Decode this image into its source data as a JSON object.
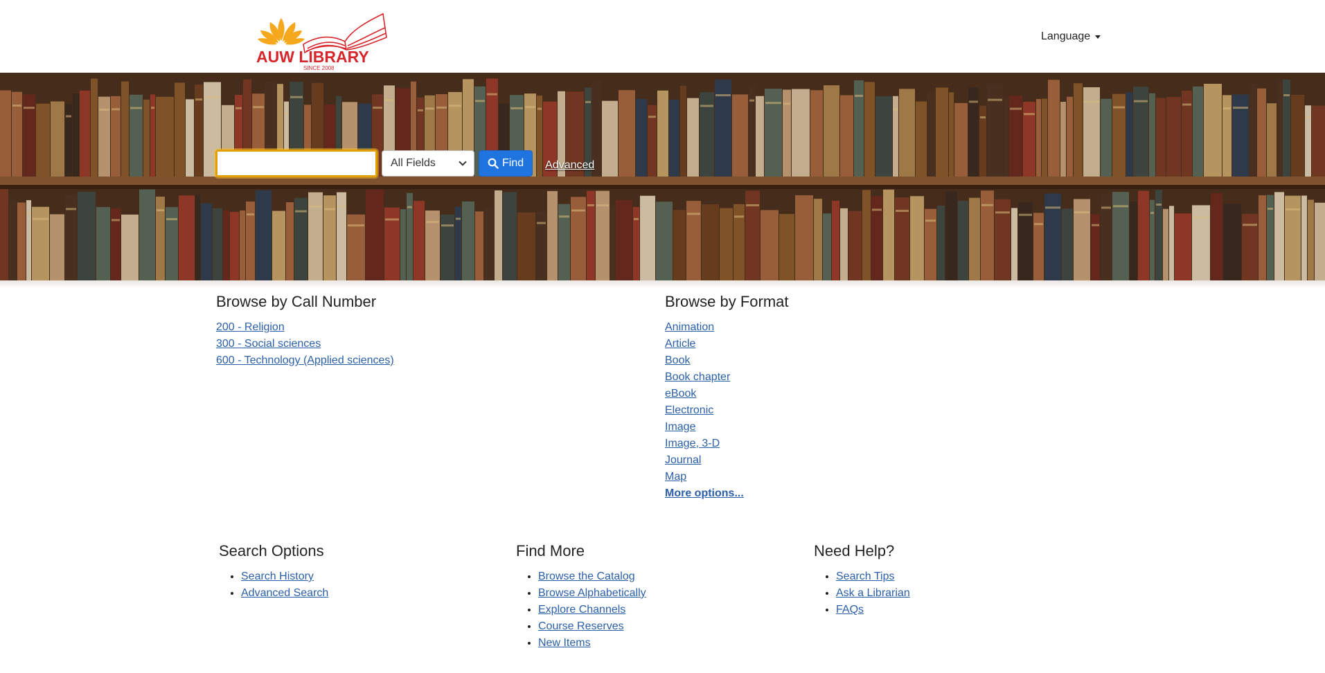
{
  "header": {
    "logo_text": "AUW LIBRARY",
    "logo_tagline": "SINCE 2008",
    "language_label": "Language"
  },
  "search": {
    "value": "",
    "placeholder": "",
    "field_selected": "All Fields",
    "find_label": "Find",
    "advanced_label": "Advanced"
  },
  "browse_call_number": {
    "title": "Browse by Call Number",
    "items": [
      "200 - Religion",
      "300 - Social sciences",
      "600 - Technology (Applied sciences)"
    ]
  },
  "browse_format": {
    "title": "Browse by Format",
    "items": [
      "Animation",
      "Article",
      "Book",
      "Book chapter",
      "eBook",
      "Electronic",
      "Image",
      "Image, 3-D",
      "Journal",
      "Map"
    ],
    "more_label": "More options..."
  },
  "footer": {
    "search_options": {
      "title": "Search Options",
      "items": [
        "Search History",
        "Advanced Search"
      ]
    },
    "find_more": {
      "title": "Find More",
      "items": [
        "Browse the Catalog",
        "Browse Alphabetically",
        "Explore Channels",
        "Course Reserves",
        "New Items"
      ]
    },
    "need_help": {
      "title": "Need Help?",
      "items": [
        "Search Tips",
        "Ask a Librarian",
        "FAQs"
      ]
    }
  },
  "colors": {
    "link": "#2b5fa8",
    "find_button": "#1f74e0",
    "logo_red": "#d7262b",
    "logo_yellow": "#f6a81c",
    "search_focus": "#e2a100"
  },
  "icons": {
    "logo": "lotus-book-logo",
    "find": "magnifier-icon",
    "language": "caret-down-icon",
    "field_select": "chevron-down-icon"
  }
}
